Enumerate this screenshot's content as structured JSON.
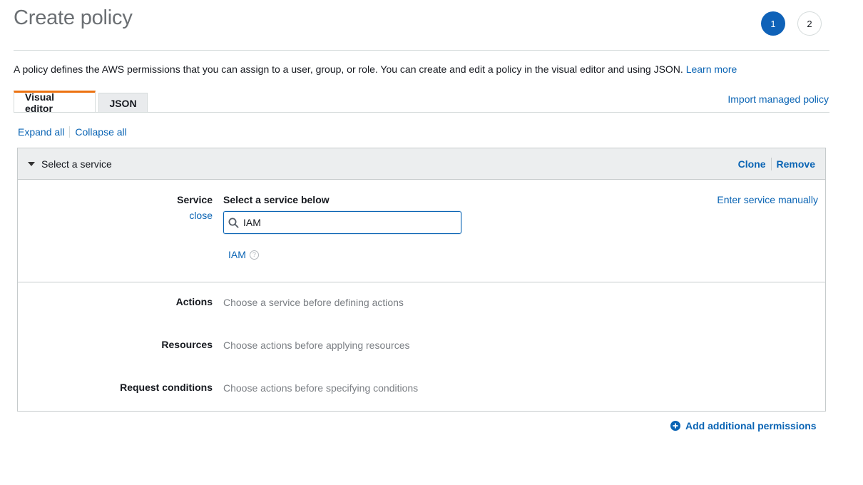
{
  "page": {
    "title": "Create policy",
    "steps": [
      "1",
      "2"
    ],
    "active_step": "1"
  },
  "description": {
    "text": "A policy defines the AWS permissions that you can assign to a user, group, or role. You can create and edit a policy in the visual editor and using JSON.",
    "learn_more": "Learn more"
  },
  "tabs": [
    {
      "label": "Visual editor",
      "selected": true
    },
    {
      "label": "JSON",
      "selected": false
    }
  ],
  "import_link": "Import managed policy",
  "expand_all": "Expand all",
  "collapse_all": "Collapse all",
  "panel": {
    "title": "Select a service",
    "clone": "Clone",
    "remove": "Remove",
    "service": {
      "label": "Service",
      "close": "close",
      "heading": "Select a service below",
      "enter_manually": "Enter service manually",
      "search_value": "IAM",
      "result": "IAM"
    },
    "actions": {
      "label": "Actions",
      "value": "Choose a service before defining actions"
    },
    "resources": {
      "label": "Resources",
      "value": "Choose actions before applying resources"
    },
    "conditions": {
      "label": "Request conditions",
      "value": "Choose actions before specifying conditions"
    }
  },
  "add_permissions": "Add additional permissions",
  "icons": {
    "search": "search-icon",
    "caret": "caret-down-icon",
    "help": "help-icon",
    "plus": "plus-circle-icon"
  },
  "colors": {
    "link": "#0a64b4",
    "active_step": "#0f62b8",
    "tab_accent": "#ec7211"
  }
}
